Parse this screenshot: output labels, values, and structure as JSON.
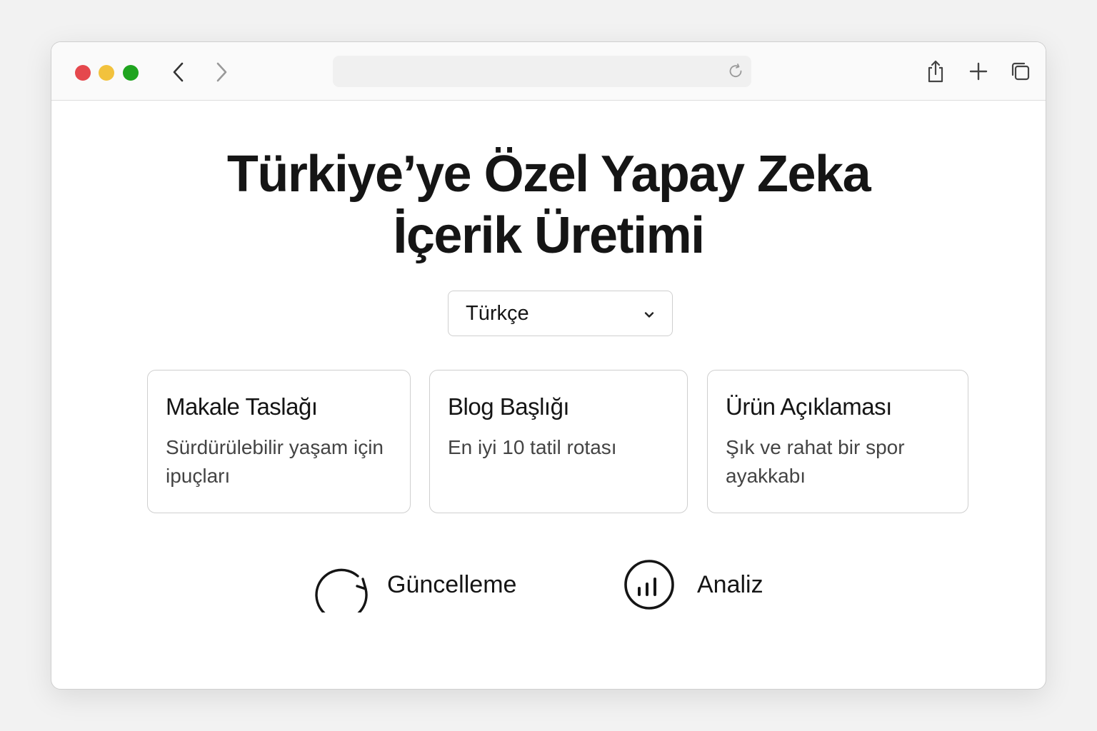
{
  "browser": {
    "window_controls": {
      "close_color": "#e5484d",
      "minimize_color": "#f2c23d",
      "maximize_color": "#1fa41f"
    },
    "icons": {
      "back": "chevron-left-icon",
      "forward": "chevron-right-icon",
      "reload": "reload-icon",
      "share": "share-icon",
      "new_tab": "plus-icon",
      "tabs": "tabs-overview-icon"
    }
  },
  "hero": {
    "title_line1": "Türkiye’ye Özel Yapay Zeka",
    "title_line2": "İçerik Üretimi"
  },
  "language_select": {
    "selected": "Türkçe"
  },
  "cards": [
    {
      "title": "Makale Taslağı",
      "description": "Sürdürülebilir yaşam için ipuçları"
    },
    {
      "title": "Blog Başlığı",
      "description": "En iyi 10 tatil rotası"
    },
    {
      "title": "Ürün Açıklaması",
      "description": "Şık ve rahat bir spor ayakkabı"
    }
  ],
  "actions": {
    "update": {
      "label": "Güncelleme",
      "icon": "refresh-icon"
    },
    "analysis": {
      "label": "Analiz",
      "icon": "bar-chart-icon"
    }
  }
}
